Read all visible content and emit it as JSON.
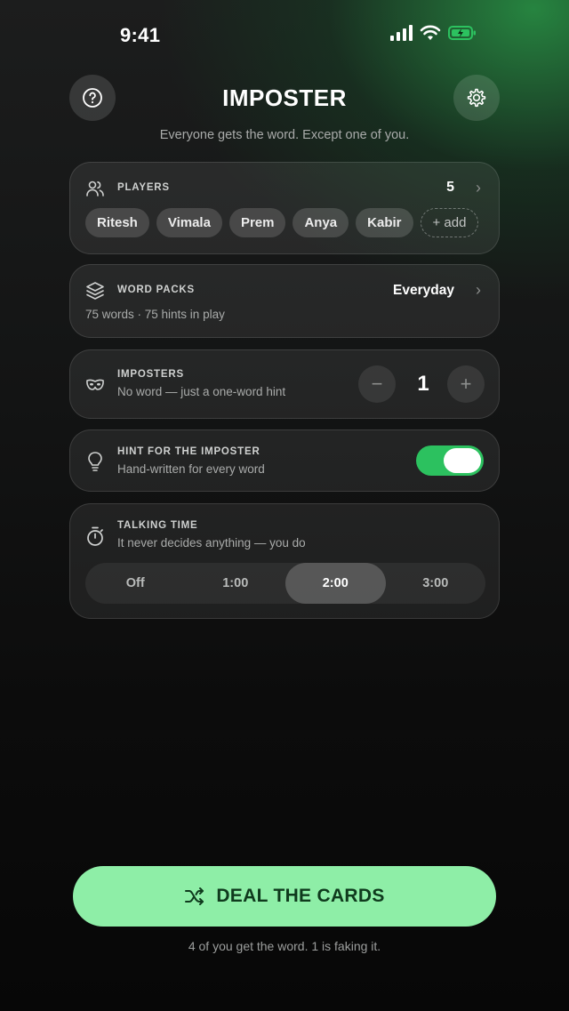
{
  "status_bar": {
    "time": "9:41"
  },
  "header": {
    "help_icon": "question-circle-icon",
    "title": "IMPOSTER",
    "settings_icon": "gear-icon",
    "subtitle": "Everyone gets the word. Except one of you."
  },
  "players": {
    "label": "PLAYERS",
    "count": "5",
    "names": [
      "Ritesh",
      "Vimala",
      "Prem",
      "Anya",
      "Kabir"
    ],
    "add_label": "+ add"
  },
  "word_packs": {
    "label": "WORD PACKS",
    "value": "Everyday",
    "description": "75 words · 75 hints in play"
  },
  "imposters": {
    "label": "IMPOSTERS",
    "description": "No word — just a one-word hint",
    "count": "1",
    "minus": "−",
    "plus": "+"
  },
  "hint": {
    "label": "HINT FOR THE IMPOSTER",
    "description": "Hand-written for every word",
    "enabled": true
  },
  "talking_time": {
    "label": "TALKING TIME",
    "description": "It never decides anything — you do",
    "options": [
      "Off",
      "1:00",
      "2:00",
      "3:00"
    ],
    "selected": "2:00"
  },
  "deal": {
    "label": "DEAL THE CARDS",
    "icon": "shuffle-icon",
    "footnote": "4 of you get the word. 1 is faking it."
  },
  "colors": {
    "accent": "#2cc15f",
    "deal_button": "#8eeea7"
  }
}
